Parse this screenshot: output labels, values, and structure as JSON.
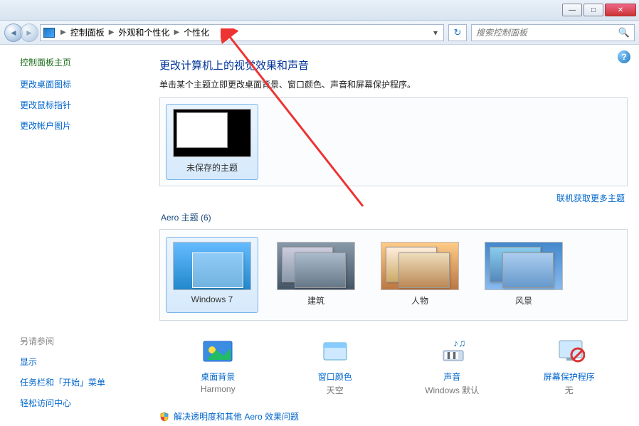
{
  "titlebar": {
    "min": "—",
    "max": "□",
    "close": "✕"
  },
  "nav": {
    "crumbs": [
      "控制面板",
      "外观和个性化",
      "个性化"
    ],
    "search_placeholder": "搜索控制面板"
  },
  "sidebar": {
    "home": "控制面板主页",
    "links": [
      "更改桌面图标",
      "更改鼠标指针",
      "更改帐户图片"
    ],
    "seealso_title": "另请参阅",
    "seealso": [
      "显示",
      "任务栏和「开始」菜单",
      "轻松访问中心"
    ]
  },
  "main": {
    "title": "更改计算机上的视觉效果和声音",
    "subtitle": "单击某个主题立即更改桌面背景、窗口颜色、声音和屏幕保护程序。",
    "unsaved_theme": "未保存的主题",
    "more_themes": "联机获取更多主题",
    "aero_section": "Aero 主题 (6)",
    "aero_themes": [
      {
        "name": "Windows 7",
        "selected": true
      },
      {
        "name": "建筑",
        "selected": false
      },
      {
        "name": "人物",
        "selected": false
      },
      {
        "name": "风景",
        "selected": false
      }
    ],
    "bottom": [
      {
        "label": "桌面背景",
        "value": "Harmony"
      },
      {
        "label": "窗口颜色",
        "value": "天空"
      },
      {
        "label": "声音",
        "value": "Windows 默认"
      },
      {
        "label": "屏幕保护程序",
        "value": "无"
      }
    ],
    "troubleshoot": "解决透明度和其他 Aero 效果问题"
  }
}
